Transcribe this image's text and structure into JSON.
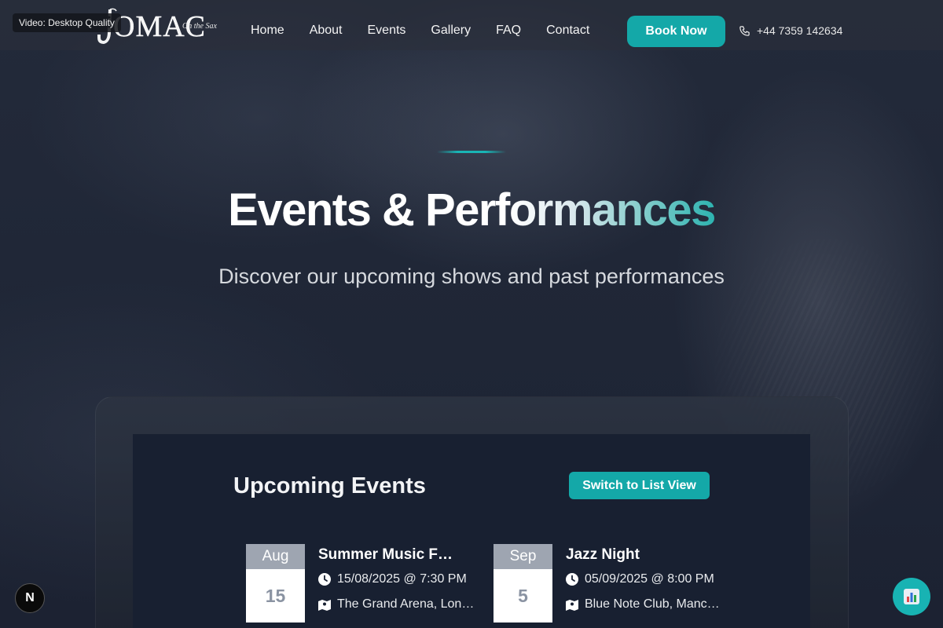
{
  "video_tag": "Video: Desktop Quality",
  "brand": {
    "logo_main": "OMAC",
    "logo_sub": "On the Sax"
  },
  "nav": {
    "links": [
      "Home",
      "About",
      "Events",
      "Gallery",
      "FAQ",
      "Contact"
    ],
    "book_label": "Book Now",
    "phone": "+44 7359 142634"
  },
  "hero": {
    "title_part1": "Events & Perf",
    "title_part2": "ormances",
    "subtitle": "Discover our upcoming shows and past performances"
  },
  "events": {
    "heading": "Upcoming Events",
    "switch_label": "Switch to List View",
    "items": [
      {
        "month": "Aug",
        "day": "15",
        "title": "Summer Music Festival",
        "datetime": "15/08/2025 @ 7:30 PM",
        "venue": "The Grand Arena, London"
      },
      {
        "month": "Sep",
        "day": "5",
        "title": "Jazz Night",
        "datetime": "05/09/2025 @ 8:00 PM",
        "venue": "Blue Note Club, Manchester"
      }
    ]
  },
  "widgets": {
    "dev_badge": "N"
  },
  "colors": {
    "accent": "#14a8a8",
    "background": "#1b2230"
  }
}
